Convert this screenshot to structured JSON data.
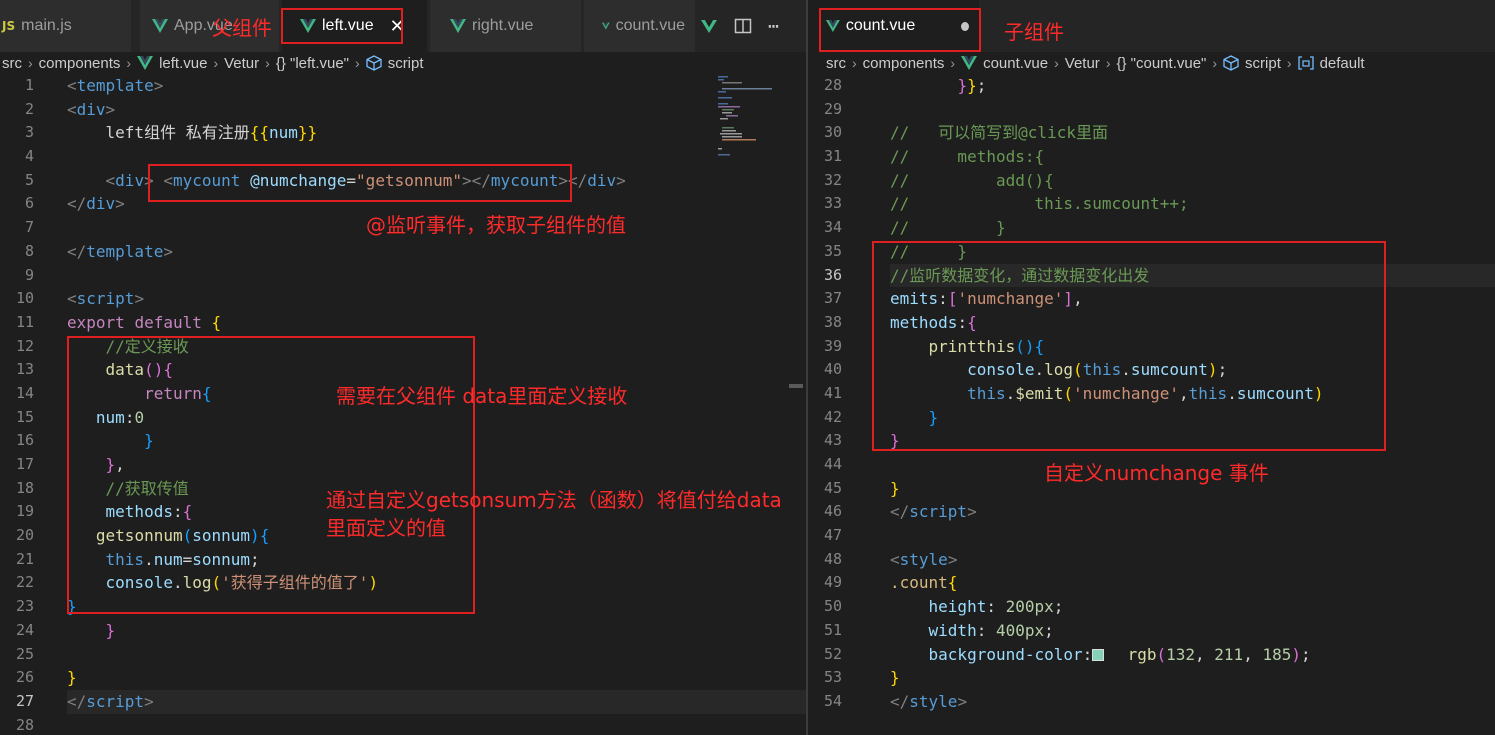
{
  "left_pane": {
    "tabs": [
      {
        "label": "main.js",
        "icon": "js-icon",
        "active": false
      },
      {
        "label": "App.vue",
        "icon": "vue-icon",
        "active": false
      },
      {
        "label": "left.vue",
        "icon": "vue-icon",
        "active": true
      },
      {
        "label": "right.vue",
        "icon": "vue-icon",
        "active": false
      },
      {
        "label": "count.vue",
        "icon": "vue-icon",
        "active": false
      }
    ],
    "breadcrumb": [
      "src",
      "components",
      "left.vue",
      "Vetur",
      "{} \"left.vue\"",
      "script"
    ],
    "line_numbers": [
      "1",
      "2",
      "3",
      "4",
      "5",
      "6",
      "7",
      "8",
      "9",
      "10",
      "11",
      "12",
      "13",
      "14",
      "15",
      "16",
      "17",
      "18",
      "19",
      "20",
      "21",
      "22",
      "23",
      "24",
      "25",
      "26",
      "27",
      "28"
    ],
    "current_line": "27",
    "code_lines": [
      [
        [
          "tk-punc",
          "<"
        ],
        [
          "tk-tag",
          "template"
        ],
        [
          "tk-punc",
          ">"
        ]
      ],
      [
        [
          "tk-punc",
          "<"
        ],
        [
          "tk-tag",
          "div"
        ],
        [
          "tk-punc",
          ">"
        ]
      ],
      [
        [
          "tk-txt",
          "    left组件 私有注册"
        ],
        [
          "tk-b1",
          "{{"
        ],
        [
          "tk-var",
          "num"
        ],
        [
          "tk-b1",
          "}}"
        ]
      ],
      [],
      [
        [
          "tk-txt",
          "    "
        ],
        [
          "tk-punc",
          "<"
        ],
        [
          "tk-tag",
          "div"
        ],
        [
          "tk-punc",
          ">"
        ],
        [
          "tk-txt",
          " "
        ],
        [
          "tk-punc",
          "<"
        ],
        [
          "tk-tag",
          "mycount"
        ],
        [
          "tk-txt",
          " "
        ],
        [
          "tk-attr",
          "@numchange"
        ],
        [
          "tk-txt",
          "="
        ],
        [
          "tk-str",
          "\"getsonnum\""
        ],
        [
          "tk-punc",
          "></"
        ],
        [
          "tk-tag",
          "mycount"
        ],
        [
          "tk-punc",
          ">"
        ],
        [
          "tk-punc",
          "</"
        ],
        [
          "tk-tag",
          "div"
        ],
        [
          "tk-punc",
          ">"
        ]
      ],
      [
        [
          "tk-punc",
          "</"
        ],
        [
          "tk-tag",
          "div"
        ],
        [
          "tk-punc",
          ">"
        ]
      ],
      [],
      [
        [
          "tk-punc",
          "</"
        ],
        [
          "tk-tag",
          "template"
        ],
        [
          "tk-punc",
          ">"
        ]
      ],
      [],
      [
        [
          "tk-punc",
          "<"
        ],
        [
          "tk-tag",
          "script"
        ],
        [
          "tk-punc",
          ">"
        ]
      ],
      [
        [
          "tk-kw",
          "export"
        ],
        [
          "tk-txt",
          " "
        ],
        [
          "tk-kw",
          "default"
        ],
        [
          "tk-txt",
          " "
        ],
        [
          "tk-b1",
          "{"
        ]
      ],
      [
        [
          "tk-cm",
          "    //定义接收"
        ]
      ],
      [
        [
          "tk-txt",
          "    "
        ],
        [
          "tk-fn",
          "data"
        ],
        [
          "tk-b2",
          "()"
        ],
        [
          "tk-b2",
          "{"
        ]
      ],
      [
        [
          "tk-txt",
          "        "
        ],
        [
          "tk-kw",
          "return"
        ],
        [
          "tk-b3",
          "{"
        ]
      ],
      [
        [
          "tk-txt",
          "   "
        ],
        [
          "tk-prop",
          "num"
        ],
        [
          "tk-txt",
          ":"
        ],
        [
          "tk-num",
          "0"
        ]
      ],
      [
        [
          "tk-txt",
          "        "
        ],
        [
          "tk-b3",
          "}"
        ]
      ],
      [
        [
          "tk-txt",
          "    "
        ],
        [
          "tk-b2",
          "}"
        ],
        [
          "tk-txt",
          ","
        ]
      ],
      [
        [
          "tk-cm",
          "    //获取传值"
        ]
      ],
      [
        [
          "tk-txt",
          "    "
        ],
        [
          "tk-prop",
          "methods"
        ],
        [
          "tk-txt",
          ":"
        ],
        [
          "tk-b2",
          "{"
        ]
      ],
      [
        [
          "tk-txt",
          "   "
        ],
        [
          "tk-fn",
          "getsonnum"
        ],
        [
          "tk-b3",
          "("
        ],
        [
          "tk-var",
          "sonnum"
        ],
        [
          "tk-b3",
          ")"
        ],
        [
          "tk-b3",
          "{"
        ]
      ],
      [
        [
          "tk-txt",
          "    "
        ],
        [
          "tk-this",
          "this"
        ],
        [
          "tk-txt",
          "."
        ],
        [
          "tk-prop",
          "num"
        ],
        [
          "tk-txt",
          "="
        ],
        [
          "tk-var",
          "sonnum"
        ],
        [
          "tk-txt",
          ";"
        ]
      ],
      [
        [
          "tk-txt",
          "    "
        ],
        [
          "tk-var",
          "console"
        ],
        [
          "tk-txt",
          "."
        ],
        [
          "tk-fn",
          "log"
        ],
        [
          "tk-b1",
          "("
        ],
        [
          "tk-str",
          "'获得子组件的值了'"
        ],
        [
          "tk-b1",
          ")"
        ]
      ],
      [
        [
          "tk-b3",
          "}"
        ]
      ],
      [
        [
          "tk-txt",
          "    "
        ],
        [
          "tk-b2",
          "}"
        ]
      ],
      [],
      [
        [
          "tk-b1",
          "}"
        ]
      ],
      [
        [
          "tk-punc",
          "</"
        ],
        [
          "tk-tag",
          "script"
        ],
        [
          "tk-punc",
          ">"
        ]
      ],
      []
    ]
  },
  "right_pane": {
    "tab": {
      "label": "count.vue",
      "icon": "vue-icon",
      "unsaved": true
    },
    "breadcrumb": [
      "src",
      "components",
      "count.vue",
      "Vetur",
      "{} \"count.vue\"",
      "script",
      "default"
    ],
    "line_numbers": [
      "28",
      "29",
      "30",
      "31",
      "32",
      "33",
      "34",
      "35",
      "36",
      "37",
      "38",
      "39",
      "40",
      "41",
      "42",
      "43",
      "44",
      "45",
      "46",
      "47",
      "48",
      "49",
      "50",
      "51",
      "52",
      "53",
      "54"
    ],
    "current_line": "36",
    "code_lines": [
      [
        [
          "tk-txt",
          "       "
        ],
        [
          "tk-b2",
          "}"
        ],
        [
          "tk-b1",
          "}"
        ],
        [
          "tk-txt",
          ";"
        ]
      ],
      [],
      [
        [
          "tk-cm",
          "//   可以简写到@click里面"
        ]
      ],
      [
        [
          "tk-cm",
          "//     methods:{"
        ]
      ],
      [
        [
          "tk-cm",
          "//         add(){"
        ]
      ],
      [
        [
          "tk-cm",
          "//             this.sumcount++;"
        ]
      ],
      [
        [
          "tk-cm",
          "//         }"
        ]
      ],
      [
        [
          "tk-cm",
          "//     }"
        ]
      ],
      [
        [
          "tk-cm",
          "//监听数据变化，通过数据变化出发"
        ]
      ],
      [
        [
          "tk-prop",
          "emits"
        ],
        [
          "tk-txt",
          ":"
        ],
        [
          "tk-b2",
          "["
        ],
        [
          "tk-str",
          "'numchange'"
        ],
        [
          "tk-b2",
          "]"
        ],
        [
          "tk-txt",
          ","
        ]
      ],
      [
        [
          "tk-prop",
          "methods"
        ],
        [
          "tk-txt",
          ":"
        ],
        [
          "tk-b2",
          "{"
        ]
      ],
      [
        [
          "tk-txt",
          "    "
        ],
        [
          "tk-fn",
          "printthis"
        ],
        [
          "tk-b3",
          "()"
        ],
        [
          "tk-b3",
          "{"
        ]
      ],
      [
        [
          "tk-txt",
          "        "
        ],
        [
          "tk-var",
          "console"
        ],
        [
          "tk-txt",
          "."
        ],
        [
          "tk-fn",
          "log"
        ],
        [
          "tk-b1",
          "("
        ],
        [
          "tk-this",
          "this"
        ],
        [
          "tk-txt",
          "."
        ],
        [
          "tk-prop",
          "sumcount"
        ],
        [
          "tk-b1",
          ")"
        ],
        [
          "tk-txt",
          ";"
        ]
      ],
      [
        [
          "tk-txt",
          "        "
        ],
        [
          "tk-this",
          "this"
        ],
        [
          "tk-txt",
          "."
        ],
        [
          "tk-fn",
          "$emit"
        ],
        [
          "tk-b1",
          "("
        ],
        [
          "tk-str",
          "'numchange'"
        ],
        [
          "tk-txt",
          ","
        ],
        [
          "tk-this",
          "this"
        ],
        [
          "tk-txt",
          "."
        ],
        [
          "tk-prop",
          "sumcount"
        ],
        [
          "tk-b1",
          ")"
        ]
      ],
      [
        [
          "tk-txt",
          "    "
        ],
        [
          "tk-b3",
          "}"
        ]
      ],
      [
        [
          "tk-b2",
          "}"
        ]
      ],
      [],
      [
        [
          "tk-b1",
          "}"
        ]
      ],
      [
        [
          "tk-punc",
          "</"
        ],
        [
          "tk-tag",
          "script"
        ],
        [
          "tk-punc",
          ">"
        ]
      ],
      [],
      [
        [
          "tk-punc",
          "<"
        ],
        [
          "tk-tag",
          "style"
        ],
        [
          "tk-punc",
          ">"
        ]
      ],
      [
        [
          "tk-cls",
          ".count"
        ],
        [
          "tk-b1",
          "{"
        ]
      ],
      [
        [
          "tk-txt",
          "    "
        ],
        [
          "tk-prop",
          "height"
        ],
        [
          "tk-txt",
          ": "
        ],
        [
          "tk-num",
          "200px"
        ],
        [
          "tk-txt",
          ";"
        ]
      ],
      [
        [
          "tk-txt",
          "    "
        ],
        [
          "tk-prop",
          "width"
        ],
        [
          "tk-txt",
          ": "
        ],
        [
          "tk-num",
          "400px"
        ],
        [
          "tk-txt",
          ";"
        ]
      ],
      [
        [
          "tk-txt",
          "    "
        ],
        [
          "tk-prop",
          "background-color"
        ],
        [
          "tk-txt",
          ":"
        ],
        [
          "swatch",
          ""
        ],
        [
          "tk-txt",
          "  "
        ],
        [
          "tk-fn",
          "rgb"
        ],
        [
          "tk-b2",
          "("
        ],
        [
          "tk-num",
          "132"
        ],
        [
          "tk-txt",
          ", "
        ],
        [
          "tk-num",
          "211"
        ],
        [
          "tk-txt",
          ", "
        ],
        [
          "tk-num",
          "185"
        ],
        [
          "tk-b2",
          ")"
        ],
        [
          "tk-txt",
          ";"
        ]
      ],
      [
        [
          "tk-b1",
          "}"
        ]
      ],
      [
        [
          "tk-punc",
          "</"
        ],
        [
          "tk-tag",
          "style"
        ],
        [
          "tk-punc",
          ">"
        ]
      ]
    ]
  },
  "annotations": {
    "parent_component": "父组件",
    "child_component": "子组件",
    "listen_event": "@监听事件，获取子组件的值",
    "define_in_data": "需要在父组件 data里面定义接收",
    "custom_method_line1": "通过自定义getsonsum方法（函数）将值付给data",
    "custom_method_line2": "里面定义的值",
    "custom_event": "自定义numchange 事件"
  },
  "colors": {
    "annotation": "#e02020",
    "vue_green": "#41b883",
    "swatch": "#84d3b9"
  }
}
